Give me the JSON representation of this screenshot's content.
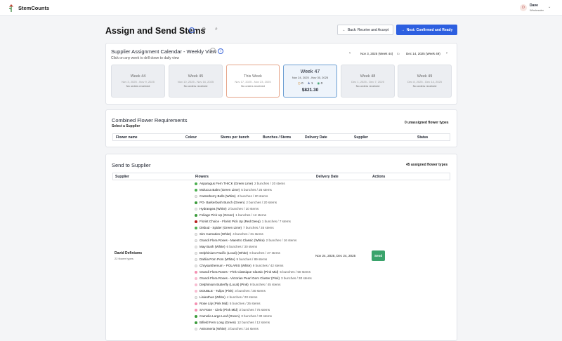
{
  "app": {
    "name": "StemCounts"
  },
  "user": {
    "initial": "D",
    "name": "Dave",
    "role": "Wholesaler"
  },
  "page": {
    "title": "Assign and Send Stems"
  },
  "actions": {
    "back_label": "Back: Receive and Accept",
    "next_label": "Next: Confirmed and Ready"
  },
  "calendar": {
    "title": "Supplier Assignment Calendar - Weekly View",
    "subtitle": "Click on any week to drill down to daily view",
    "range_start": "Nov 3, 2025 (Week 44)",
    "range_sep": "to",
    "range_end": "Dec 14, 2025 (Week 49)",
    "weeks": [
      {
        "label": "Week 44",
        "range": "Nov 3, 2025 - Nov 9, 2025",
        "status": "No orders received",
        "state": "normal"
      },
      {
        "label": "Week 45",
        "range": "Nov 10, 2025 - Nov 16, 2025",
        "status": "No orders received",
        "state": "normal"
      },
      {
        "label": "This Week",
        "range": "Nov 17, 2025 - Nov 23, 2025",
        "status": "No orders received",
        "state": "current"
      },
      {
        "label": "Week 47",
        "range": "Nov 24, 2025 - Nov 30, 2025",
        "state": "selected",
        "counts": [
          "0",
          "1",
          "0"
        ],
        "amount": "$821.30"
      },
      {
        "label": "Week 48",
        "range": "Dec 1, 2025 - Dec 7, 2025",
        "status": "No orders received",
        "state": "normal"
      },
      {
        "label": "Week 49",
        "range": "Dec 8, 2025 - Dec 14, 2025",
        "status": "No orders received",
        "state": "normal"
      }
    ]
  },
  "combined": {
    "title": "Combined Flower Requirements",
    "subtitle": "Select a Supplier",
    "badge": "0 unassigned flower types",
    "columns": [
      "Flower name",
      "Colour",
      "Stems per bunch",
      "Bunches / Stems",
      "Delivery Date",
      "Supplier",
      "Status"
    ]
  },
  "send": {
    "title": "Send to Supplier",
    "badge": "45 assigned flower types",
    "columns": [
      "Supplier",
      "Flowers",
      "Delivery Date",
      "Actions"
    ],
    "row": {
      "supplier": "David Definiums",
      "types": "22 flower types",
      "delivery": "Nov 24, 2025, Dec 24, 2025",
      "action": "Send",
      "flowers": [
        {
          "name": "Asparagus Fern THICK (Green Lime)",
          "qty": "2 bunches / 20 stems",
          "color": "#4caf50"
        },
        {
          "name": "Molucca Balm (Green Lime)",
          "qty": "5 bunches / 25 stems",
          "color": "#4caf50"
        },
        {
          "name": "Canterberry Bells (White)",
          "qty": "4 bunches / 20 stems",
          "color": "#eeeeee"
        },
        {
          "name": "PG- Barkerbush Bunch (Green)",
          "qty": "2 bunches / 20 stems",
          "color": "#3a9a3a"
        },
        {
          "name": "Hydrangea (White)",
          "qty": "2 bunches / 10 stems",
          "color": "#eeeeee"
        },
        {
          "name": "Foliage Pick Up (Green)",
          "qty": "1 bunches / 12 stems",
          "color": "#3a9a3a"
        },
        {
          "name": "Florist Choice - Florist Pick Up (Red Deep)",
          "qty": "1 bunches / 7 stems",
          "color": "#b71c1c"
        },
        {
          "name": "Disbud - Spider (Green Lime)",
          "qty": "7 bunches / 35 stems",
          "color": "#4caf50"
        },
        {
          "name": "Sim Carnation (White)",
          "qty": "4 bunches / 31 stems",
          "color": "#eeeeee"
        },
        {
          "name": "Grandi Flora Roses - Maestro Classic (White)",
          "qty": "2 bunches / 16 stems",
          "color": "#eeeeee"
        },
        {
          "name": "May Bush (White)",
          "qty": "6 bunches / 30 stems",
          "color": "#eeeeee"
        },
        {
          "name": "Delphinium Pacific (Local) (White)",
          "qty": "6 bunches / 27 stems",
          "color": "#eeeeee"
        },
        {
          "name": "Dahlia Pom Pom (White)",
          "qty": "9 bunches / 89 stems",
          "color": "#eeeeee"
        },
        {
          "name": "Chrysanthemum - POLARIS (White)",
          "qty": "9 bunches / 42 stems",
          "color": "#eeeeee"
        },
        {
          "name": "Grandi Flora Roses - Pink Classique Classic (Pink Mid)",
          "qty": "5 bunches / 50 stems",
          "color": "#f48fb1"
        },
        {
          "name": "Grandi Flora Roses - Victorian Pearl Gem Cluster (Pink)",
          "qty": "3 bunches / 30 stems",
          "color": "#f8bbd0"
        },
        {
          "name": "Delphinium Butterfly (Local) (Pink)",
          "qty": "9 bunches / 45 stems",
          "color": "#f8bbd0"
        },
        {
          "name": "DOUBLE - Tulips (Pink)",
          "qty": "3 bunches / 30 stems",
          "color": "#f8bbd0"
        },
        {
          "name": "Lisianthus (White)",
          "qty": "4 bunches / 20 stems",
          "color": "#eeeeee"
        },
        {
          "name": "Rose Lily (Pink Mid)",
          "qty": "5 bunches / 25 stems",
          "color": "#f48fb1"
        },
        {
          "name": "SA Rose - Cielo (Pink Mid)",
          "qty": "3 bunches / 75 stems",
          "color": "#f48fb1"
        },
        {
          "name": "Camelia Large Leaf (Green)",
          "qty": "3 bunches / 30 stems",
          "color": "#3a9a3a"
        },
        {
          "name": "Bifield Fern Long (Green)",
          "qty": "12 bunches / 12 stems",
          "color": "#3a9a3a"
        },
        {
          "name": "Astromeria (White)",
          "qty": "3 bunches / 24 stems",
          "color": "#eeeeee"
        }
      ]
    }
  }
}
